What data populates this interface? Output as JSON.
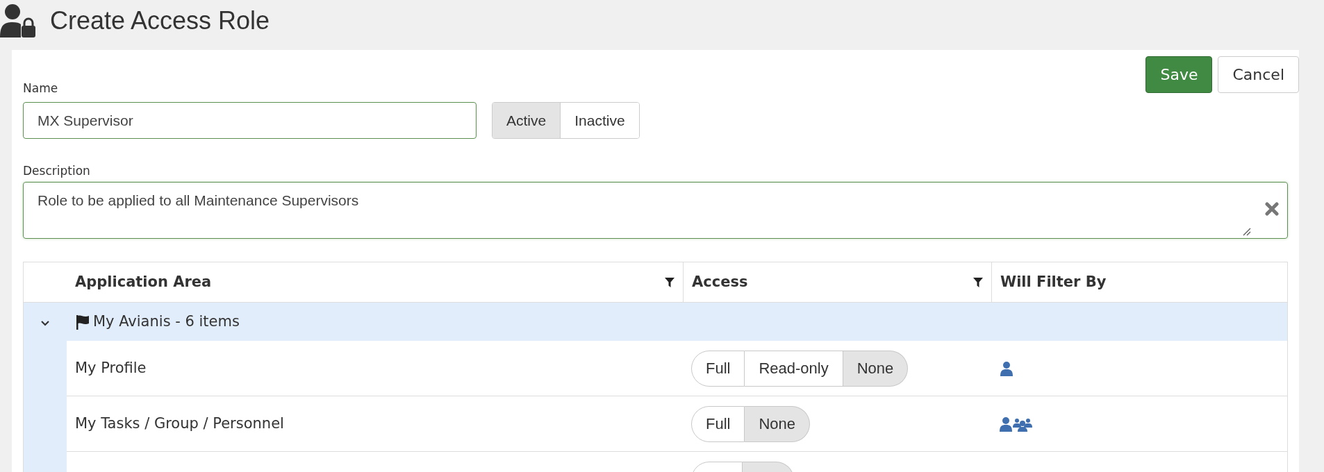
{
  "page": {
    "title": "Create Access Role"
  },
  "actions": [
    {
      "label": "Save",
      "kind": "primary"
    },
    {
      "label": "Cancel",
      "kind": "secondary"
    }
  ],
  "name_field": {
    "label": "Name",
    "value": "MX Supervisor"
  },
  "status_toggle": [
    {
      "label": "Active",
      "selected": true
    },
    {
      "label": "Inactive",
      "selected": false
    }
  ],
  "description_field": {
    "label": "Description",
    "value": "Role to be applied to all Maintenance Supervisors"
  },
  "table": {
    "columns": [
      {
        "label": "Application Area",
        "filter": true
      },
      {
        "label": "Access",
        "filter": true
      },
      {
        "label": "Will Filter By",
        "filter": false
      }
    ],
    "groups": [
      {
        "label": "My Avianis - 6 items",
        "expanded": true,
        "rows": [
          {
            "area": "My Profile",
            "access": [
              {
                "label": "Full",
                "selected": false
              },
              {
                "label": "Read-only",
                "selected": false
              },
              {
                "label": "None",
                "selected": true
              }
            ],
            "filter_by": {
              "kind": "person"
            }
          },
          {
            "area": "My Tasks / Group / Personnel",
            "access": [
              {
                "label": "Full",
                "selected": false
              },
              {
                "label": "None",
                "selected": true
              }
            ],
            "filter_by": {
              "kind": "person-and-group"
            }
          },
          {
            "access": [
              {
                "selected": false
              },
              {
                "selected": true
              }
            ]
          }
        ]
      }
    ]
  }
}
